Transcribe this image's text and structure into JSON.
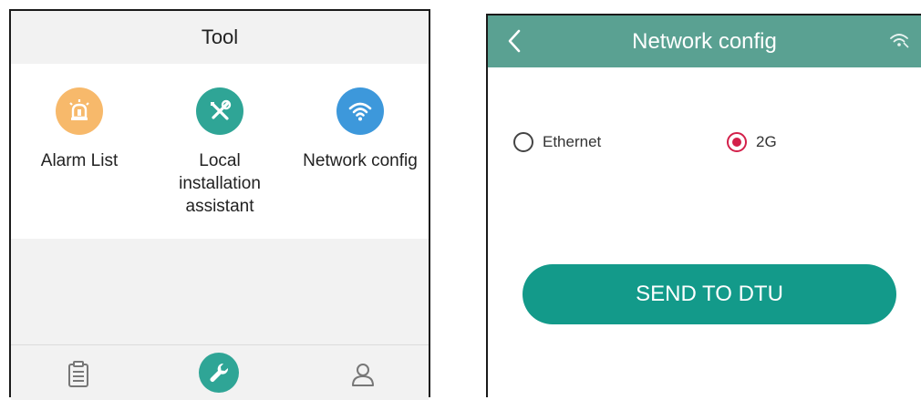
{
  "tool_screen": {
    "title": "Tool",
    "items": [
      {
        "label": "Alarm List",
        "icon": "alarm-light-icon",
        "color": "#f7b96b"
      },
      {
        "label": "Local\ninstallation\nassistant",
        "icon": "tools-icon",
        "color": "#2fa596"
      },
      {
        "label": "Network config",
        "icon": "wifi-icon",
        "color": "#3d98db"
      }
    ],
    "bottom_nav": [
      {
        "icon": "clipboard-icon"
      },
      {
        "icon": "wrench-icon",
        "active": true,
        "color": "#2fa596"
      },
      {
        "icon": "user-icon"
      }
    ]
  },
  "network_screen": {
    "title": "Network config",
    "header_color": "#5aa192",
    "options": [
      {
        "label": "Ethernet",
        "selected": false
      },
      {
        "label": "2G",
        "selected": true
      }
    ],
    "selected_color": "#d3204a",
    "send_button": "SEND TO DTU",
    "button_color": "#139a8a"
  }
}
